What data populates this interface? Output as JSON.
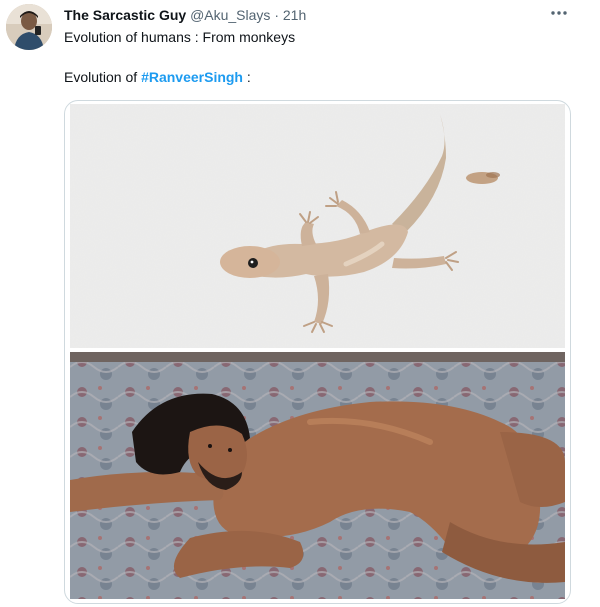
{
  "tweet": {
    "display_name": "The Sarcastic Guy",
    "handle": "@Aku_Slays",
    "separator": "·",
    "time": "21h",
    "line1": "Evolution of humans : From monkeys",
    "line2_prefix": "Evolution of ",
    "hashtag": "#RanveerSingh",
    "line2_suffix": " :",
    "media": [
      {
        "description_icon": "lizard-photo"
      },
      {
        "description_icon": "man-lying-on-carpet-photo"
      }
    ]
  },
  "colors": {
    "text_primary": "#0f1419",
    "text_secondary": "#536471",
    "link": "#1d9bf0",
    "border": "#cfd9de"
  },
  "icons": {
    "more": "more-icon",
    "avatar": "avatar"
  }
}
